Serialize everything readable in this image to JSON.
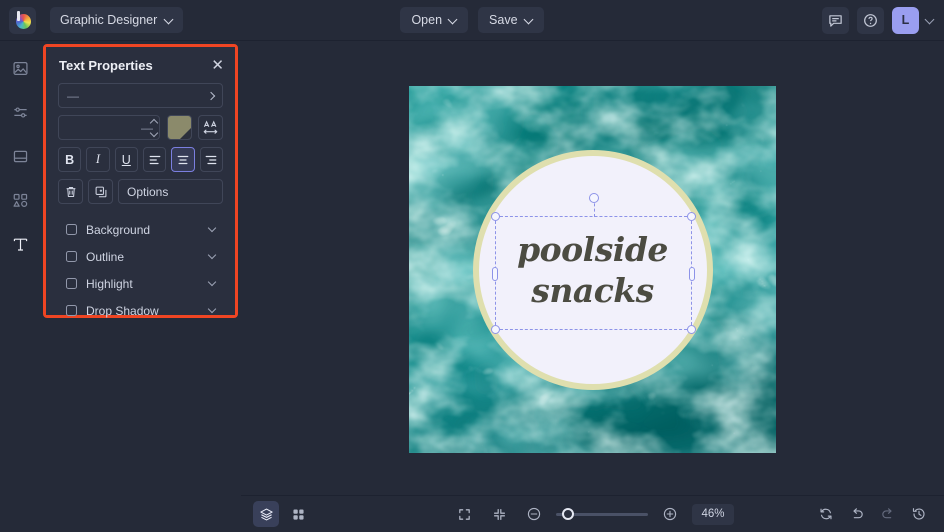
{
  "app": {
    "logo_icon": "color-wheel-logo",
    "document_title": "Graphic Designer"
  },
  "topbar": {
    "open_label": "Open",
    "save_label": "Save",
    "comment_icon": "comment-icon",
    "help_icon": "help-circle-icon",
    "avatar_initial": "L",
    "avatar_chevron_icon": "chevron-down-icon"
  },
  "left_rail": {
    "items": [
      {
        "name": "images",
        "icon": "image-icon",
        "active": false
      },
      {
        "name": "adjust",
        "icon": "sliders-icon",
        "active": false
      },
      {
        "name": "layout",
        "icon": "layout-icon",
        "active": false
      },
      {
        "name": "elements",
        "icon": "shapes-icon",
        "active": false
      },
      {
        "name": "text",
        "icon": "text-t-icon",
        "active": true
      }
    ]
  },
  "panel": {
    "title": "Text Properties",
    "close_icon": "close-icon",
    "highlight_color": "#ef4523",
    "font_family_value": "—",
    "font_family_caret_icon": "chevron-right-icon",
    "font_size_value": "—",
    "stepper_up_icon": "chevron-up-icon",
    "stepper_down_icon": "chevron-down-icon",
    "color_swatch": "#8b8a6b",
    "letter_spacing_icon": "AA",
    "format_buttons": [
      {
        "name": "bold",
        "label": "B"
      },
      {
        "name": "italic",
        "label": "I"
      },
      {
        "name": "underline",
        "label": "U"
      }
    ],
    "align_buttons": [
      {
        "name": "align-left",
        "selected": false
      },
      {
        "name": "align-center",
        "selected": true
      },
      {
        "name": "align-right",
        "selected": false
      }
    ],
    "delete_icon": "trash-icon",
    "duplicate_icon": "duplicate-icon",
    "options_label": "Options",
    "options_caret_icon": "chevron-right-icon",
    "toggles": [
      {
        "label": "Background",
        "checked": false
      },
      {
        "label": "Outline",
        "checked": false
      },
      {
        "label": "Highlight",
        "checked": false
      },
      {
        "label": "Drop Shadow",
        "checked": false
      }
    ]
  },
  "canvas": {
    "artwork_line1": "poolside",
    "artwork_line2": "snacks",
    "text_color": "#4c4c42",
    "circle_fill": "#f2f1fb",
    "circle_border": "#dfdfae",
    "background_description": "swimming pool water",
    "selection": {
      "rotate_handle_icon": "rotate-handle",
      "handles": [
        "top-left",
        "top-right",
        "bottom-left",
        "bottom-right",
        "middle-left",
        "middle-right"
      ]
    }
  },
  "bottombar": {
    "layers_icon": "layers-icon",
    "grid_icon": "grid-icon",
    "fullscreen_icon": "fullscreen-icon",
    "fit_icon": "fit-to-screen-icon",
    "zoom_out_icon": "minus-circle-icon",
    "zoom_in_icon": "plus-circle-icon",
    "zoom_level": "46%",
    "reset_icon": "reset-icon",
    "undo_icon": "undo-icon",
    "redo_icon": "redo-icon",
    "history_icon": "history-icon"
  }
}
